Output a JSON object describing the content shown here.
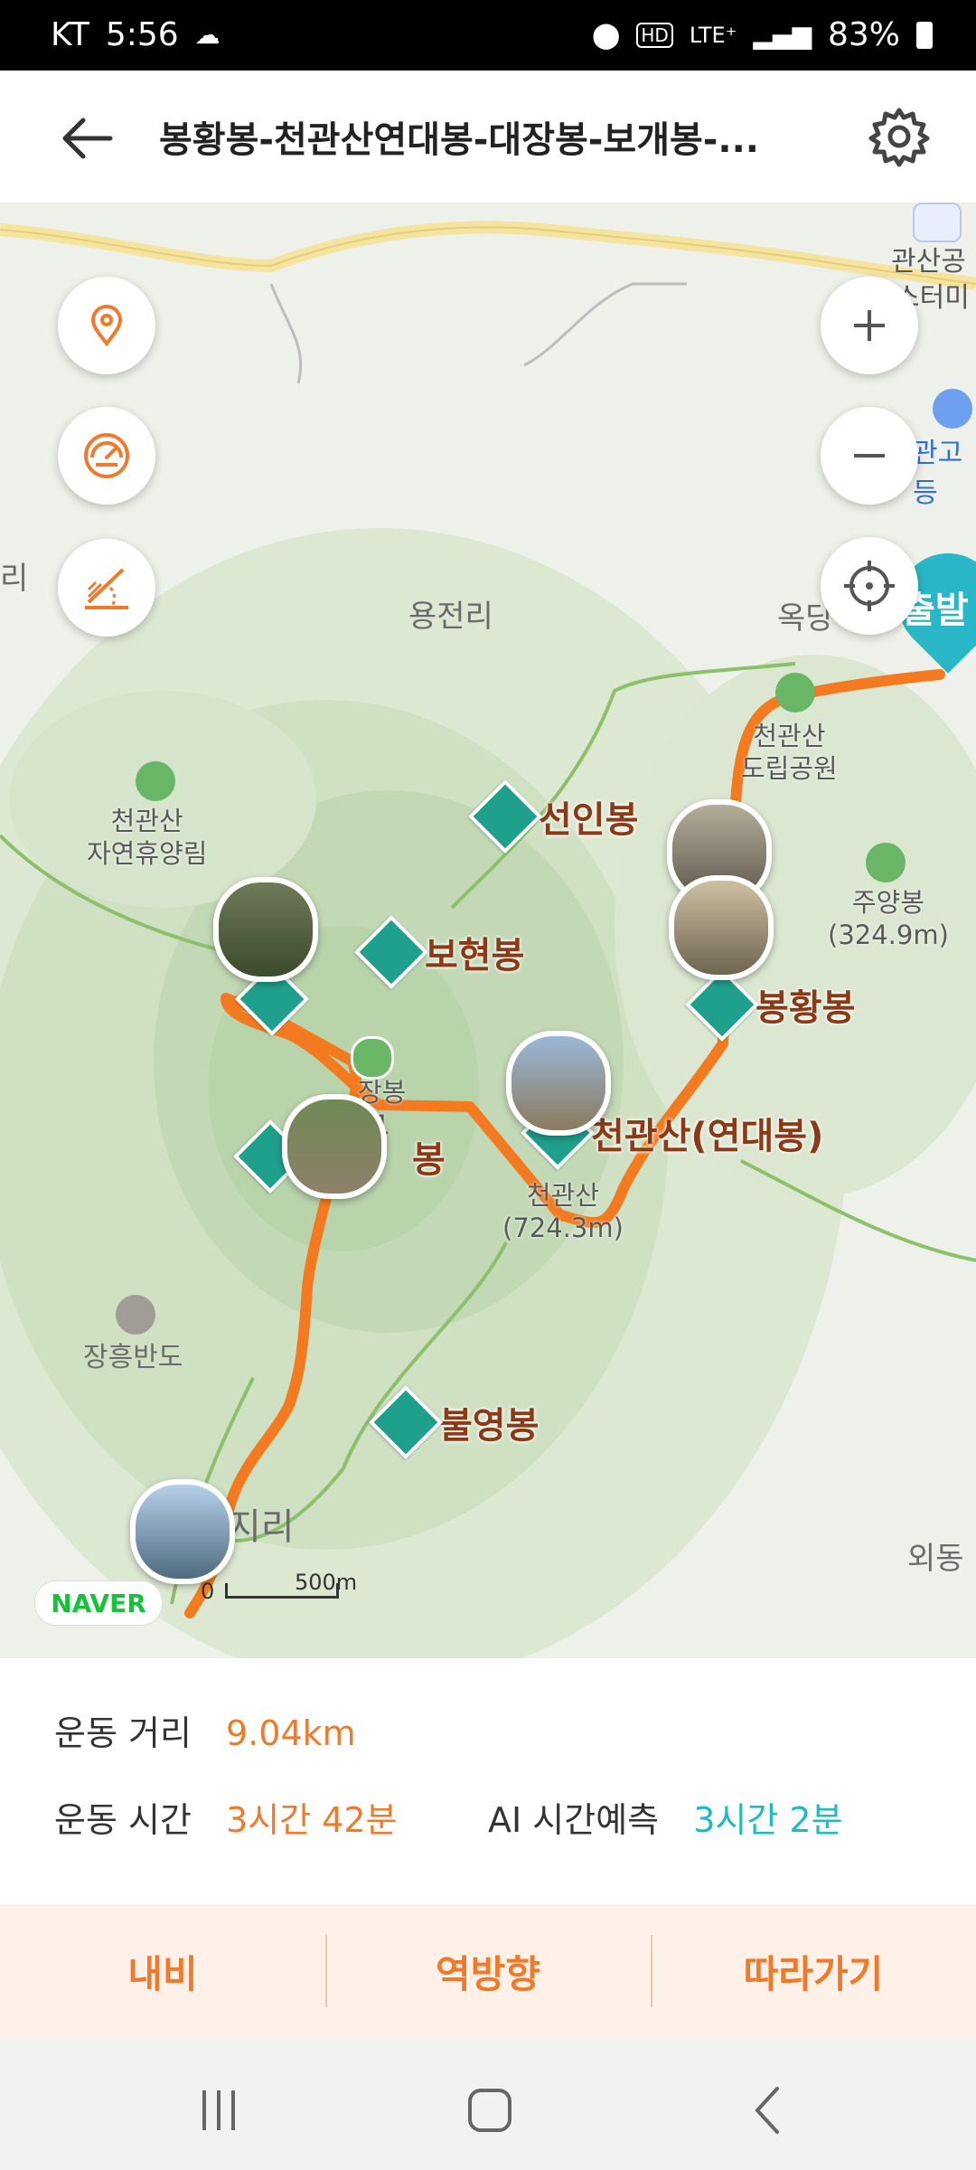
{
  "status_bar": {
    "carrier": "KT",
    "time": "5:56",
    "network": "LTE⁺",
    "battery": "83%"
  },
  "header": {
    "title": "봉황봉-천관산연대봉-대장봉-보개봉-..."
  },
  "map": {
    "places": {
      "yongjeon": "용전리",
      "okdang": "옥당",
      "jangheung": "장흥반도",
      "oedong": "외동",
      "jiri": "지리",
      "gwansan": "관산공",
      "terminal": "스터미",
      "school": "관고등",
      "ri": "리"
    },
    "start_badge": "출발",
    "peaks": {
      "seonin": "선인봉",
      "bohyeon": "보현봉",
      "bonghwang": "봉황봉",
      "cheongwan": "천관산(연대봉)",
      "bulyeong": "불영봉",
      "daejang_partial": "봉"
    },
    "labels": {
      "park_line1": "천관산",
      "park_line2": "도립공원",
      "forest_line1": "천관산",
      "forest_line2": "자연휴양림",
      "juyang_line1": "주양봉",
      "juyang_line2": "(324.9m)",
      "summit_line1": "천관산",
      "summit_line2": "(724.3m)",
      "daejang_line1": "장봉",
      "daejang_line2": "1"
    },
    "naver": "NAVER",
    "scale_zero": "0",
    "scale_label": "500m"
  },
  "stats": {
    "distance_label": "운동 거리",
    "distance_value": "9.04km",
    "time_label": "운동 시간",
    "time_value": "3시간 42분",
    "ai_label": "AI 시간예측",
    "ai_value": "3시간 2분"
  },
  "actions": {
    "navi": "내비",
    "reverse": "역방향",
    "follow": "따라가기"
  },
  "colors": {
    "route": "#f47a20",
    "accent_orange": "#f07a2c",
    "accent_teal": "#20b9c2",
    "peak_marker": "#1fa08c",
    "start_badge": "#29b6c6"
  },
  "icons": [
    "back-arrow-icon",
    "gear-icon",
    "location-pin-icon",
    "speedometer-icon",
    "elevation-icon",
    "zoom-in-icon",
    "zoom-out-icon",
    "crosshair-icon",
    "recent-apps-icon",
    "home-icon",
    "back-nav-icon"
  ]
}
